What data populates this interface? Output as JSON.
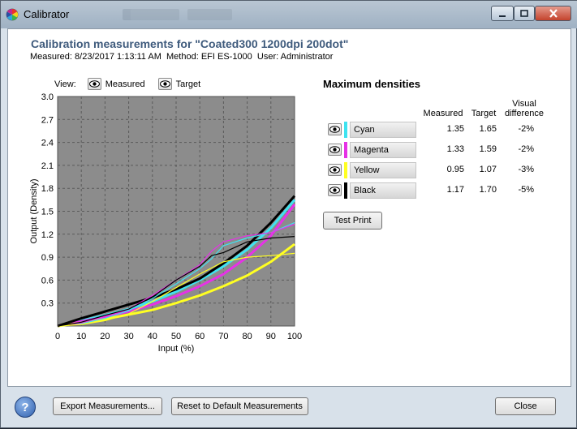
{
  "window": {
    "title": "Calibrator"
  },
  "header": {
    "title": "Calibration measurements for \"Coated300 1200dpi  200dot\"",
    "measured_label": "Measured:",
    "measured_value": "8/23/2017 1:13:11 AM",
    "method_label": "Method:",
    "method_value": "EFI ES-1000",
    "user_label": "User:",
    "user_value": "Administrator"
  },
  "view": {
    "label": "View:",
    "measured": "Measured",
    "target": "Target"
  },
  "max_densities": {
    "title": "Maximum densities",
    "columns": {
      "measured": "Measured",
      "target": "Target",
      "visual_line1": "Visual",
      "visual_line2": "difference"
    },
    "rows": [
      {
        "name": "Cyan",
        "color": "#3fe3f0",
        "measured": "1.35",
        "target": "1.65",
        "diff": "-2%"
      },
      {
        "name": "Magenta",
        "color": "#e632e6",
        "measured": "1.33",
        "target": "1.59",
        "diff": "-2%"
      },
      {
        "name": "Yellow",
        "color": "#ffff22",
        "measured": "0.95",
        "target": "1.07",
        "diff": "-3%"
      },
      {
        "name": "Black",
        "color": "#000000",
        "measured": "1.17",
        "target": "1.70",
        "diff": "-5%"
      }
    ],
    "test_print": "Test Print"
  },
  "buttons": {
    "help": "?",
    "export": "Export Measurements...",
    "reset": "Reset to Default Measurements",
    "close": "Close"
  },
  "chart_data": {
    "type": "line",
    "xlabel": "Input (%)",
    "ylabel": "Output (Density)",
    "xlim": [
      0,
      100
    ],
    "ylim": [
      0,
      3.0
    ],
    "x_ticks": [
      0,
      10,
      20,
      30,
      40,
      50,
      60,
      70,
      80,
      90,
      100
    ],
    "y_ticks": [
      0.3,
      0.6,
      0.9,
      1.2,
      1.5,
      1.8,
      2.1,
      2.4,
      2.7,
      3.0
    ],
    "y_tick_labels": [
      "0.3",
      "0.6",
      "0.9",
      "1.2",
      "1.5",
      "1.8",
      "2.1",
      "2.4",
      "2.7",
      "3.0"
    ],
    "grid": true,
    "background": "#8c8c8c",
    "series": [
      {
        "color": "#3fe3f0",
        "kind": "target",
        "x": [
          0,
          10,
          20,
          30,
          40,
          50,
          60,
          70,
          80,
          90,
          100
        ],
        "y": [
          0,
          0.07,
          0.14,
          0.22,
          0.32,
          0.45,
          0.6,
          0.78,
          1.0,
          1.28,
          1.65
        ]
      },
      {
        "color": "#e632e6",
        "kind": "target",
        "x": [
          0,
          10,
          20,
          30,
          40,
          50,
          60,
          70,
          80,
          90,
          100
        ],
        "y": [
          0,
          0.06,
          0.12,
          0.19,
          0.28,
          0.39,
          0.52,
          0.68,
          0.9,
          1.18,
          1.59
        ]
      },
      {
        "color": "#ffff22",
        "kind": "target",
        "x": [
          0,
          10,
          20,
          30,
          40,
          50,
          60,
          70,
          80,
          90,
          100
        ],
        "y": [
          0,
          0.04,
          0.09,
          0.15,
          0.21,
          0.3,
          0.4,
          0.52,
          0.66,
          0.84,
          1.07
        ]
      },
      {
        "color": "#000000",
        "kind": "target",
        "x": [
          0,
          10,
          20,
          30,
          40,
          50,
          60,
          70,
          80,
          90,
          100
        ],
        "y": [
          0,
          0.1,
          0.19,
          0.28,
          0.37,
          0.48,
          0.62,
          0.82,
          1.05,
          1.35,
          1.7
        ]
      },
      {
        "color": "#3fe3f0",
        "kind": "measured",
        "x": [
          0,
          10,
          20,
          30,
          40,
          50,
          60,
          65,
          70,
          80,
          90,
          100
        ],
        "y": [
          0,
          0.03,
          0.1,
          0.2,
          0.36,
          0.55,
          0.75,
          0.88,
          1.05,
          1.15,
          1.22,
          1.35
        ]
      },
      {
        "color": "#e632e6",
        "kind": "measured",
        "x": [
          0,
          10,
          20,
          30,
          40,
          50,
          60,
          65,
          70,
          80,
          90,
          100
        ],
        "y": [
          0,
          0.04,
          0.12,
          0.22,
          0.4,
          0.6,
          0.8,
          0.98,
          1.1,
          1.18,
          1.22,
          1.33
        ]
      },
      {
        "color": "#ffff22",
        "kind": "measured",
        "x": [
          0,
          10,
          20,
          30,
          40,
          50,
          60,
          70,
          80,
          90,
          100
        ],
        "y": [
          0,
          0.02,
          0.07,
          0.16,
          0.32,
          0.5,
          0.68,
          0.84,
          0.9,
          0.92,
          0.95
        ]
      },
      {
        "color": "#000000",
        "kind": "measured",
        "x": [
          0,
          10,
          20,
          30,
          40,
          50,
          60,
          65,
          70,
          80,
          90,
          100
        ],
        "y": [
          0,
          0.05,
          0.14,
          0.22,
          0.38,
          0.6,
          0.78,
          0.92,
          0.96,
          1.1,
          1.15,
          1.17
        ]
      }
    ]
  }
}
